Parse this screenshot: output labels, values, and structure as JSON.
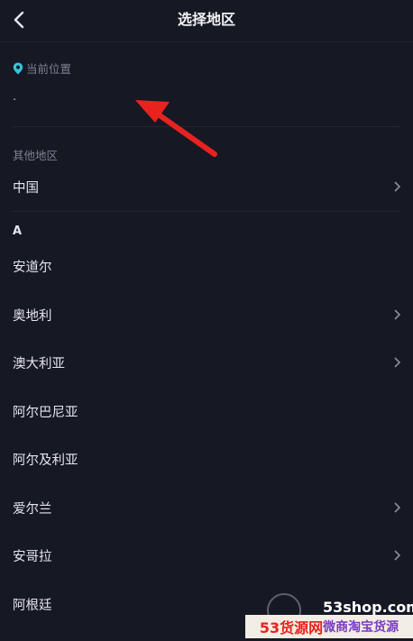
{
  "header": {
    "title": "选择地区"
  },
  "current_location": {
    "label": "当前位置",
    "value": "."
  },
  "other_regions": {
    "label": "其他地区"
  },
  "countries_top": [
    {
      "name": "中国",
      "has_children": true
    }
  ],
  "index_letter": "A",
  "countries_a": [
    {
      "name": "安道尔",
      "has_children": false
    },
    {
      "name": "奥地利",
      "has_children": true
    },
    {
      "name": "澳大利亚",
      "has_children": true
    },
    {
      "name": "阿尔巴尼亚",
      "has_children": false
    },
    {
      "name": "阿尔及利亚",
      "has_children": false
    },
    {
      "name": "爱尔兰",
      "has_children": true
    },
    {
      "name": "安哥拉",
      "has_children": true
    },
    {
      "name": "阿根廷",
      "has_children": false
    }
  ],
  "watermark": {
    "site": "53shop.com",
    "left": "53货源网",
    "right": "微商淘宝货源"
  },
  "colors": {
    "background": "#161824",
    "accent_pin": "#34c6d9",
    "annotation_arrow": "#e8231f"
  }
}
